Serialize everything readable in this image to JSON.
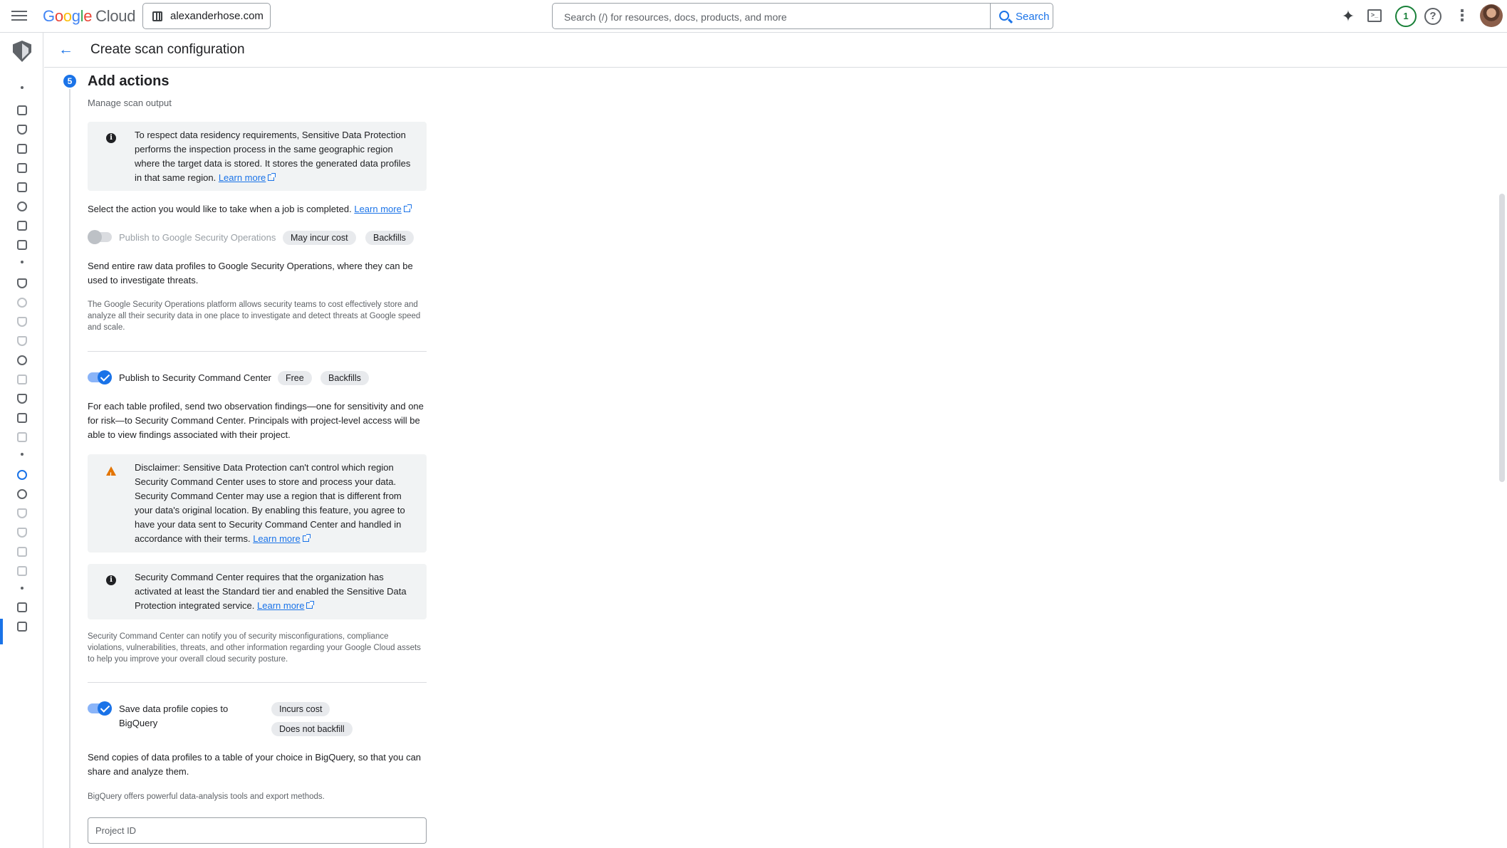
{
  "topbar": {
    "logo": {
      "google": [
        "G",
        "o",
        "o",
        "g",
        "l",
        "e"
      ],
      "cloud": "Cloud"
    },
    "project": "alexanderhose.com",
    "search_placeholder": "Search (/) for resources, docs, products, and more",
    "search_button": "Search",
    "notification_count": "1",
    "icons": {
      "gemini": "sparkle-icon",
      "terminal": "terminal-icon",
      "help": "help-icon",
      "more": "more-vert-icon"
    }
  },
  "header": {
    "title": "Create scan configuration"
  },
  "step": {
    "number": "5",
    "title": "Add actions",
    "subtitle": "Manage scan output"
  },
  "residency_notice": {
    "text": "To respect data residency requirements, Sensitive Data Protection performs the inspection process in the same geographic region where the target data is stored. It stores the generated data profiles in that same region.",
    "link": "Learn more"
  },
  "select_action": {
    "text": "Select the action you would like to take when a job is completed.",
    "link": "Learn more"
  },
  "secops": {
    "label": "Publish to Google Security Operations",
    "enabled": false,
    "chips": [
      "May incur cost",
      "Backfills"
    ],
    "description": "Send entire raw data profiles to Google Security Operations, where they can be used to investigate threats.",
    "note": "The Google Security Operations platform allows security teams to cost effectively store and analyze all their security data in one place to investigate and detect threats at Google speed and scale."
  },
  "scc": {
    "label": "Publish to Security Command Center",
    "enabled": true,
    "chips": [
      "Free",
      "Backfills"
    ],
    "description": "For each table profiled, send two observation findings—one for sensitivity and one for risk—to Security Command Center. Principals with project-level access will be able to view findings associated with their project.",
    "disclaimer": "Disclaimer: Sensitive Data Protection can't control which region Security Command Center uses to store and process your data. Security Command Center may use a region that is different from your data's original location. By enabling this feature, you agree to have your data sent to Security Command Center and handled in accordance with their terms.",
    "disclaimer_link": "Learn more",
    "tier_notice": "Security Command Center requires that the organization has activated at least the Standard tier and enabled the Sensitive Data Protection integrated service.",
    "tier_link": "Learn more",
    "note": "Security Command Center can notify you of security misconfigurations, compliance violations, vulnerabilities, threats, and other information regarding your Google Cloud assets to help you improve your overall cloud security posture."
  },
  "bigquery": {
    "label_line1": "Save data profile copies to",
    "label_line2": "BigQuery",
    "enabled": true,
    "chips": [
      "Incurs cost",
      "Does not backfill"
    ],
    "description": "Send copies of data profiles to a table of your choice in BigQuery, so that you can share and analyze them.",
    "note": "BigQuery offers powerful data-analysis tools and export methods.",
    "project_id_placeholder": "Project ID"
  },
  "colors": {
    "accent": "#1a73e8",
    "warning": "#e37400",
    "notice_bg": "#f1f3f4"
  }
}
